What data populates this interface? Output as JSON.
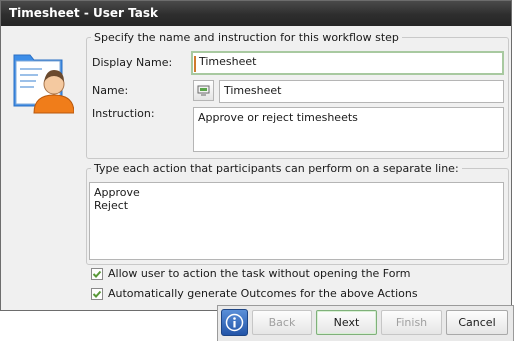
{
  "window": {
    "title": "Timesheet - User Task"
  },
  "step_group": {
    "legend": "Specify the name and instruction for this workflow step",
    "display_name_label": "Display Name:",
    "display_name_value": "Timesheet",
    "name_label": "Name:",
    "name_value": "Timesheet",
    "instruction_label": "Instruction:",
    "instruction_value": "Approve or reject timesheets"
  },
  "actions_group": {
    "legend": "Type each action that participants can perform on a separate line:",
    "actions": [
      "Approve",
      "Reject"
    ]
  },
  "options": {
    "allow_without_form": {
      "label": "Allow user to action the task without opening the Form",
      "checked": true
    },
    "auto_outcomes": {
      "label": "Automatically generate Outcomes for the above Actions",
      "checked": true
    }
  },
  "buttons": {
    "back": "Back",
    "next": "Next",
    "finish": "Finish",
    "cancel": "Cancel"
  },
  "icons": {
    "info": "info-icon",
    "step": "user-task-icon",
    "name_field": "field-reference-icon",
    "checkbox": "checkmark-icon"
  },
  "colors": {
    "title_bar": "#2e2e2e",
    "focus_border": "#a8c9a0",
    "caret": "#d07a2e",
    "checkbox": "#5a9a3a",
    "info_button": "#2f63b8"
  }
}
